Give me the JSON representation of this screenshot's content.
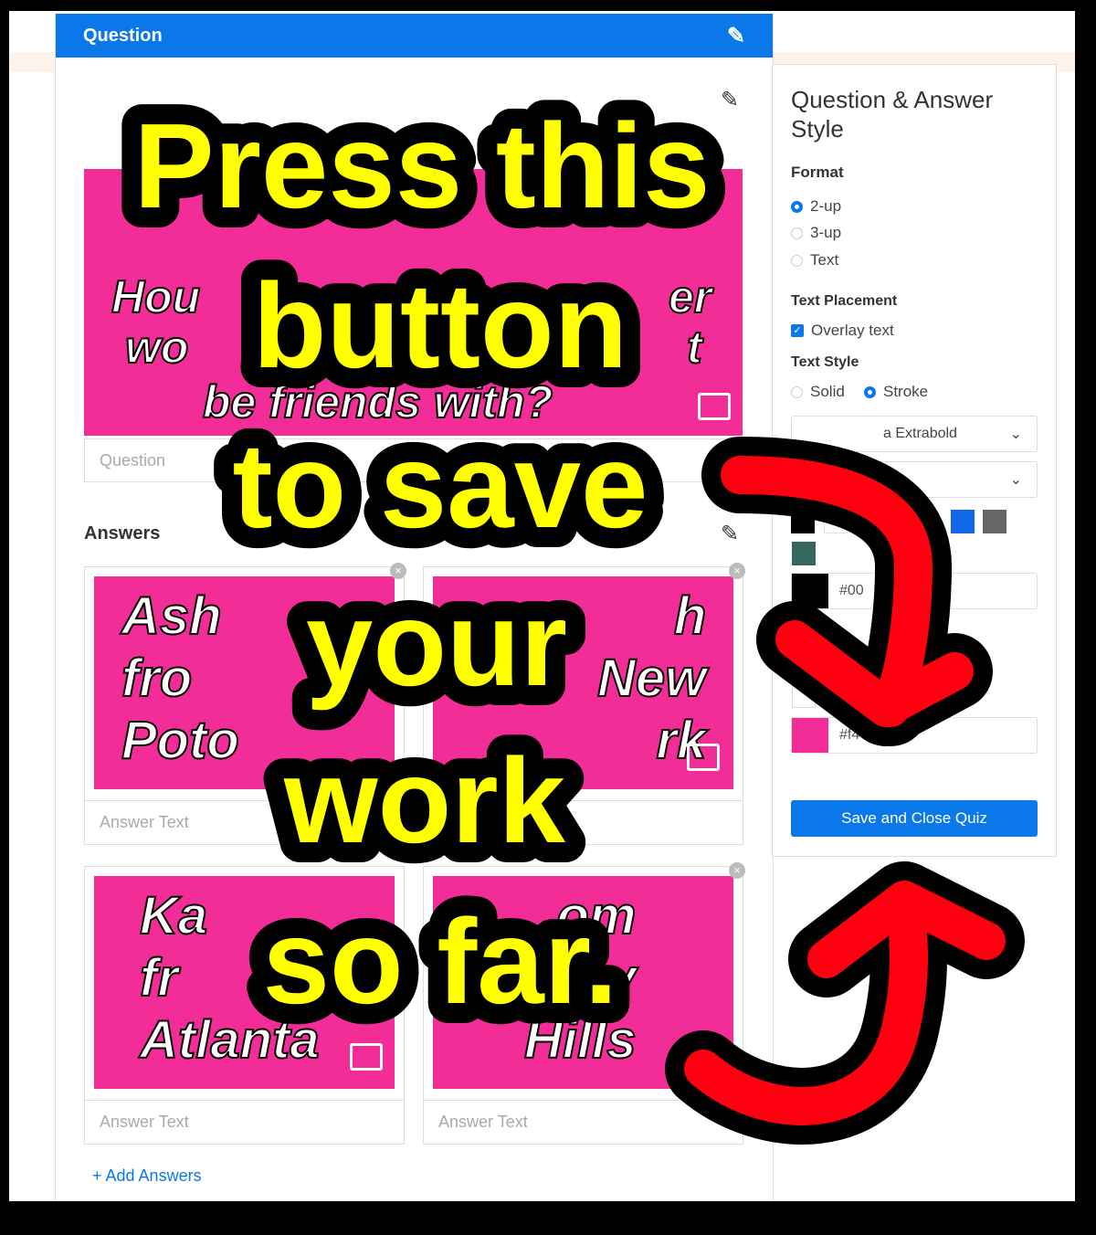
{
  "question_panel": {
    "title": "Question",
    "edit_icon": "pencil-icon",
    "question_image_text": [
      "Hou",
      "er",
      "wo",
      "t",
      "be friends with?"
    ],
    "question_placeholder": "Question",
    "answers_label": "Answers",
    "answers": [
      {
        "image_text": "Ash\nfro\nPoto",
        "placeholder": "Answer Text"
      },
      {
        "image_text": "h\nNew\nrk",
        "placeholder": ""
      },
      {
        "image_text": "Ka\nfr\nAtlanta",
        "placeholder": "Answer Text"
      },
      {
        "image_text": "om\ny\nHills",
        "placeholder": "Answer Text"
      }
    ],
    "add_answers": "+ Add Answers",
    "image_color": "#f22d97"
  },
  "style_panel": {
    "title": "Question & Answer Style",
    "format_label": "Format",
    "format_options": [
      {
        "label": "2-up",
        "selected": true
      },
      {
        "label": "3-up",
        "selected": false
      },
      {
        "label": "Text",
        "selected": false
      }
    ],
    "text_placement_label": "Text Placement",
    "overlay_text": {
      "label": "Overlay text",
      "checked": true
    },
    "text_style_label": "Text Style",
    "text_style_options": [
      {
        "label": "Solid",
        "selected": false
      },
      {
        "label": "Stroke",
        "selected": true
      }
    ],
    "font_select": "a Extrabold",
    "swatches": [
      "#000000",
      "#ffffff",
      "#1466e8",
      "#666666",
      "#356660"
    ],
    "text_color_hex": "#00",
    "bg_color_hex": "#f4",
    "save_button": "Save and Close Quiz",
    "accent": "#0a78e8"
  },
  "annotation": {
    "lines": [
      "Press this",
      "button",
      "to save",
      "your",
      "work",
      "so far."
    ],
    "text_color": "#ffff00",
    "arrow_color": "#ff0010"
  }
}
